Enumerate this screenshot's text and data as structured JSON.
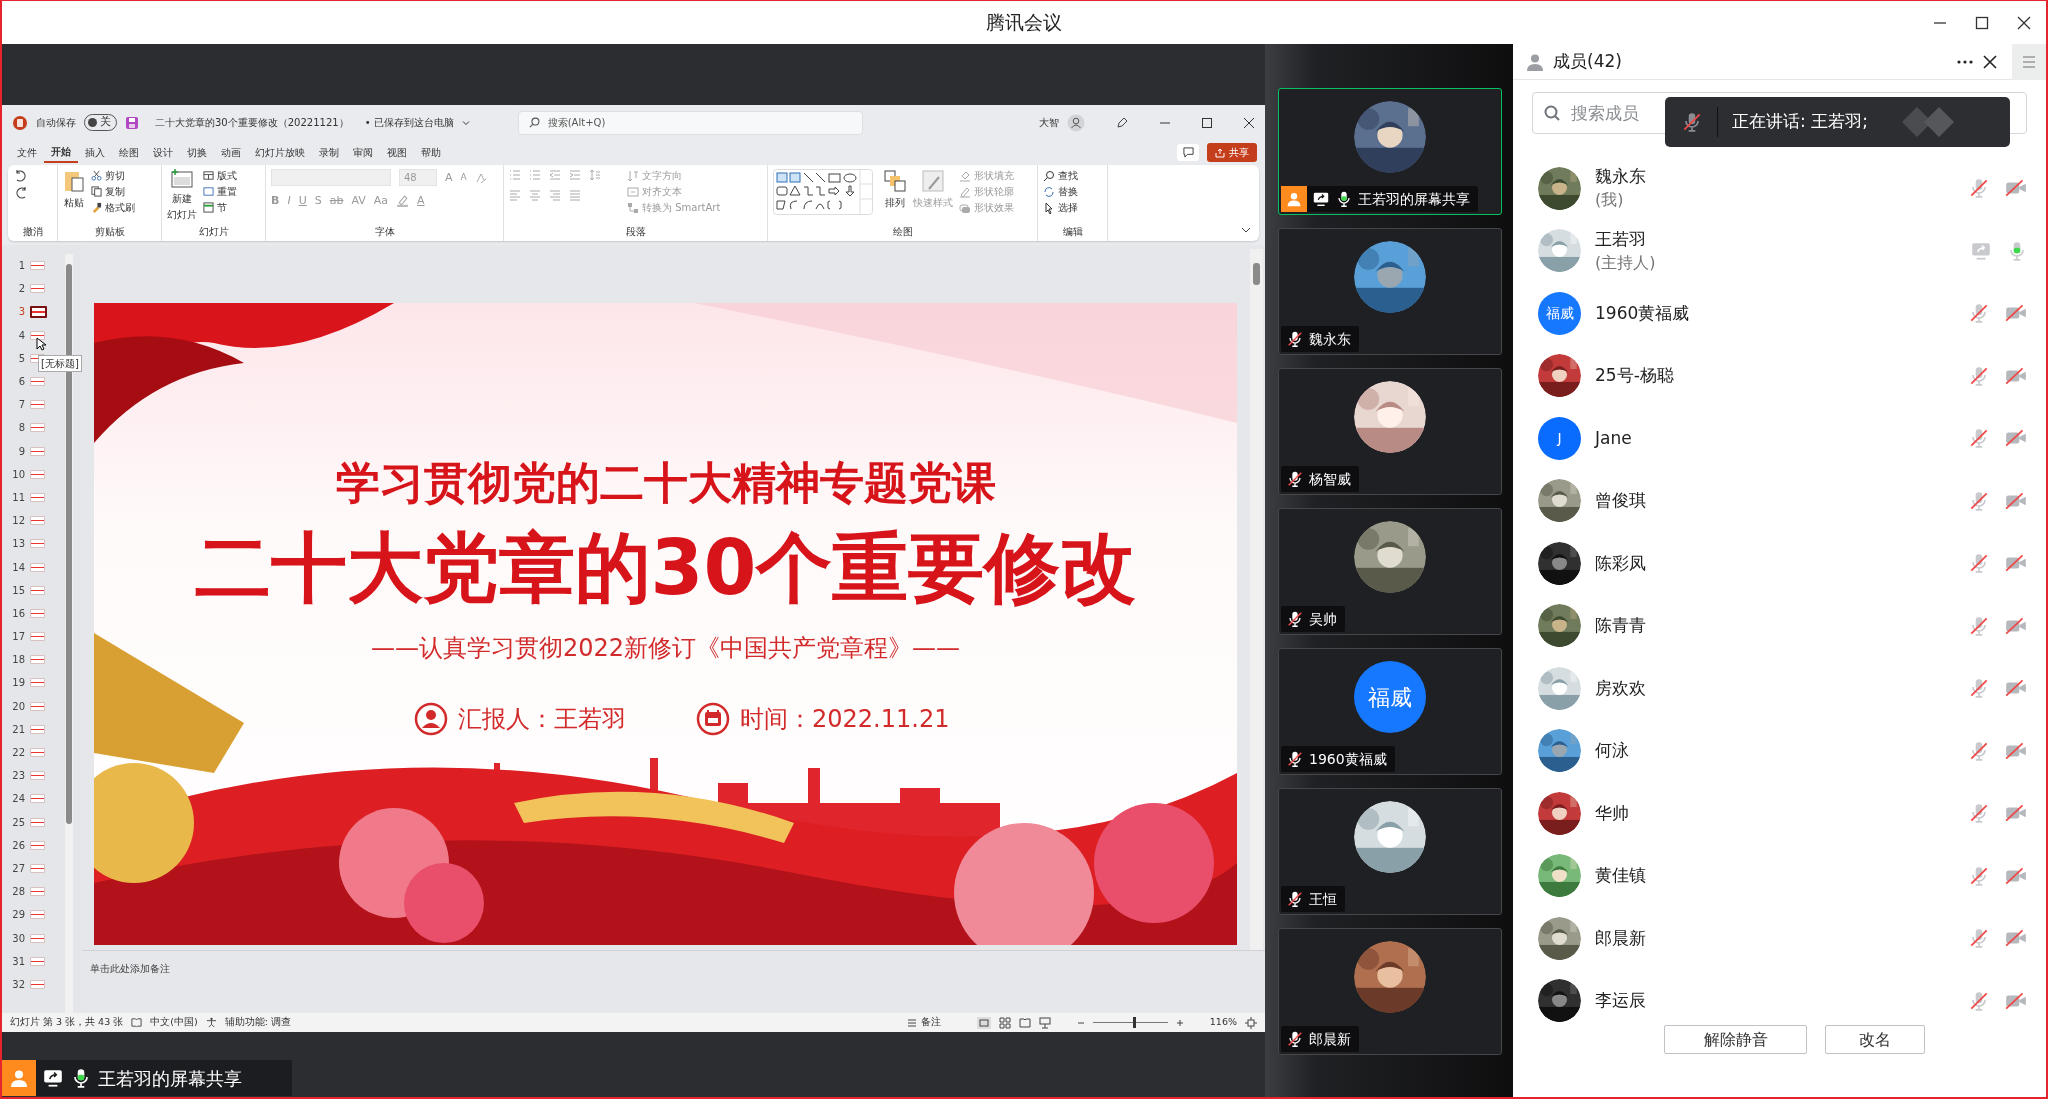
{
  "window": {
    "title": "腾讯会议"
  },
  "ppt": {
    "autosave_label": "自动保存",
    "autosave": {
      "label": "关",
      "on": false
    },
    "filename": "二十大党章的30个重要修改（20221121）",
    "save_status": "• 已保存到这台电脑",
    "search_placeholder": "搜索(Alt+Q)",
    "user": "大智",
    "share_button": "共享",
    "tabs": [
      {
        "label": "文件",
        "selected": false
      },
      {
        "label": "开始",
        "selected": true
      },
      {
        "label": "插入",
        "selected": false
      },
      {
        "label": "绘图",
        "selected": false
      },
      {
        "label": "设计",
        "selected": false
      },
      {
        "label": "切换",
        "selected": false
      },
      {
        "label": "动画",
        "selected": false
      },
      {
        "label": "幻灯片放映",
        "selected": false
      },
      {
        "label": "录制",
        "selected": false
      },
      {
        "label": "审阅",
        "selected": false
      },
      {
        "label": "视图",
        "selected": false
      },
      {
        "label": "帮助",
        "selected": false
      }
    ],
    "ribbon": [
      {
        "kind": "undo",
        "label": "撤消"
      },
      {
        "kind": "clipboard",
        "label": "剪贴板",
        "items": [
          {
            "label": "粘贴",
            "disabled": false
          },
          {
            "label": "剪切",
            "disabled": false
          },
          {
            "label": "复制",
            "disabled": false
          },
          {
            "label": "格式刷",
            "disabled": false
          }
        ]
      },
      {
        "kind": "slides",
        "label": "幻灯片",
        "items": [
          {
            "label": "新建",
            "disabled": false
          },
          {
            "label": "幻灯片",
            "disabled": false
          },
          {
            "label": "版式",
            "disabled": false
          },
          {
            "label": "重置",
            "disabled": false
          },
          {
            "label": "节",
            "disabled": false
          }
        ]
      },
      {
        "kind": "font",
        "label": "字体",
        "items": [
          {
            "label": "48",
            "disabled": true
          },
          {
            "label": "A",
            "disabled": true
          },
          {
            "label": "A",
            "disabled": true
          },
          {
            "label": "B",
            "disabled": true
          },
          {
            "label": "I",
            "disabled": true
          },
          {
            "label": "U",
            "disabled": true
          },
          {
            "label": "S",
            "disabled": true
          },
          {
            "label": "ab",
            "disabled": true
          },
          {
            "label": "AV",
            "disabled": true
          },
          {
            "label": "Aa",
            "disabled": true
          },
          {
            "label": "A",
            "disabled": true
          }
        ]
      },
      {
        "kind": "paragraph",
        "label": "段落",
        "items": [
          {
            "label": "文字方向",
            "disabled": true
          },
          {
            "label": "对齐文本",
            "disabled": true
          },
          {
            "label": "转换为 SmartArt",
            "disabled": true
          }
        ]
      },
      {
        "kind": "drawing",
        "label": "绘图",
        "items": [
          {
            "label": "排列",
            "disabled": false
          },
          {
            "label": "快速样式",
            "disabled": true
          },
          {
            "label": "形状填充",
            "disabled": true
          },
          {
            "label": "形状轮廓",
            "disabled": true
          },
          {
            "label": "形状效果",
            "disabled": true
          }
        ]
      },
      {
        "kind": "editing",
        "label": "编辑",
        "items": [
          {
            "label": "查找",
            "disabled": false
          },
          {
            "label": "替换",
            "disabled": false
          },
          {
            "label": "选择",
            "disabled": false
          }
        ]
      }
    ],
    "slides": [
      {
        "number": "1",
        "selected": false
      },
      {
        "number": "2",
        "selected": false
      },
      {
        "number": "3",
        "selected": true
      },
      {
        "number": "4",
        "selected": false
      },
      {
        "number": "5",
        "selected": false
      },
      {
        "number": "6",
        "selected": false
      },
      {
        "number": "7",
        "selected": false
      },
      {
        "number": "8",
        "selected": false
      },
      {
        "number": "9",
        "selected": false
      },
      {
        "number": "10",
        "selected": false
      },
      {
        "number": "11",
        "selected": false
      },
      {
        "number": "12",
        "selected": false
      },
      {
        "number": "13",
        "selected": false
      },
      {
        "number": "14",
        "selected": false
      },
      {
        "number": "15",
        "selected": false
      },
      {
        "number": "16",
        "selected": false
      },
      {
        "number": "17",
        "selected": false
      },
      {
        "number": "18",
        "selected": false
      },
      {
        "number": "19",
        "selected": false
      },
      {
        "number": "20",
        "selected": false
      },
      {
        "number": "21",
        "selected": false
      },
      {
        "number": "22",
        "selected": false
      },
      {
        "number": "23",
        "selected": false
      },
      {
        "number": "24",
        "selected": false
      },
      {
        "number": "25",
        "selected": false
      },
      {
        "number": "26",
        "selected": false
      },
      {
        "number": "27",
        "selected": false
      },
      {
        "number": "28",
        "selected": false
      },
      {
        "number": "29",
        "selected": false
      },
      {
        "number": "30",
        "selected": false
      },
      {
        "number": "31",
        "selected": false
      },
      {
        "number": "32",
        "selected": false
      }
    ],
    "thumbnail_tooltip": "[无标题]",
    "slide": {
      "kind": "picture",
      "title": "学习贯彻党的二十大精神专题党课",
      "headline": "二十大党章的30个重要修改",
      "subtitle": "——认真学习贯彻2022新修订《中国共产党章程》——",
      "presenter": "汇报人：王若羽",
      "date": "时间：2022.11.21"
    },
    "notes_placeholder": "单击此处添加备注",
    "status_bar": {
      "slide_info": "幻灯片 第 3 张，共 43 张",
      "language": "中文(中国)",
      "accessibility": "辅助功能: 调查",
      "notes_button": "备注",
      "zoom": {
        "level": 0.55
      },
      "zoom_percent": "116%"
    }
  },
  "share_label": "王若羽的屏幕共享",
  "video_tiles": [
    {
      "name": "王若羽的屏幕共享",
      "kind": "sharer",
      "speaking": true,
      "mic_on": true
    },
    {
      "name": "魏永东",
      "kind": "member",
      "speaking": false,
      "mic_on": false
    },
    {
      "name": "杨智威",
      "kind": "member",
      "speaking": false,
      "mic_on": false
    },
    {
      "name": "吴帅",
      "kind": "member",
      "speaking": false,
      "mic_on": false
    },
    {
      "name": "1960黄福威",
      "kind": "member",
      "speaking": false,
      "mic_on": false,
      "avatar": {
        "kind": "text",
        "text": "福威",
        "color": "#1677ff"
      }
    },
    {
      "name": "王恒",
      "kind": "member",
      "speaking": false,
      "mic_on": false
    },
    {
      "name": "郎晨新",
      "kind": "member",
      "speaking": false,
      "mic_on": false
    }
  ],
  "members_panel": {
    "title": "成员(42)",
    "search_placeholder": "搜索成员",
    "speaking_toast": "正在讲话: 王若羽;",
    "members": [
      {
        "name": "魏永东",
        "note": "(我)",
        "mic_on": false,
        "sharing": false
      },
      {
        "name": "王若羽",
        "note": "(主持人)",
        "mic_on": true,
        "sharing": true
      },
      {
        "name": "1960黄福威",
        "mic_on": false,
        "sharing": false,
        "avatar": {
          "kind": "text",
          "text": "福威",
          "color": "#1677ff"
        }
      },
      {
        "name": "25号-杨聪",
        "mic_on": false,
        "sharing": false
      },
      {
        "name": "Jane",
        "mic_on": false,
        "sharing": false,
        "avatar": {
          "kind": "text",
          "text": "J",
          "color": "#0a6cff"
        }
      },
      {
        "name": "曾俊琪",
        "mic_on": false,
        "sharing": false
      },
      {
        "name": "陈彩凤",
        "mic_on": false,
        "sharing": false
      },
      {
        "name": "陈青青",
        "mic_on": false,
        "sharing": false
      },
      {
        "name": "房欢欢",
        "mic_on": false,
        "sharing": false
      },
      {
        "name": "何泳",
        "mic_on": false,
        "sharing": false
      },
      {
        "name": "华帅",
        "mic_on": false,
        "sharing": false
      },
      {
        "name": "黄佳镇",
        "mic_on": false,
        "sharing": false
      },
      {
        "name": "郎晨新",
        "mic_on": false,
        "sharing": false
      },
      {
        "name": "李运辰",
        "mic_on": false,
        "sharing": false
      }
    ],
    "buttons": [
      "解除静音",
      "改名"
    ]
  }
}
